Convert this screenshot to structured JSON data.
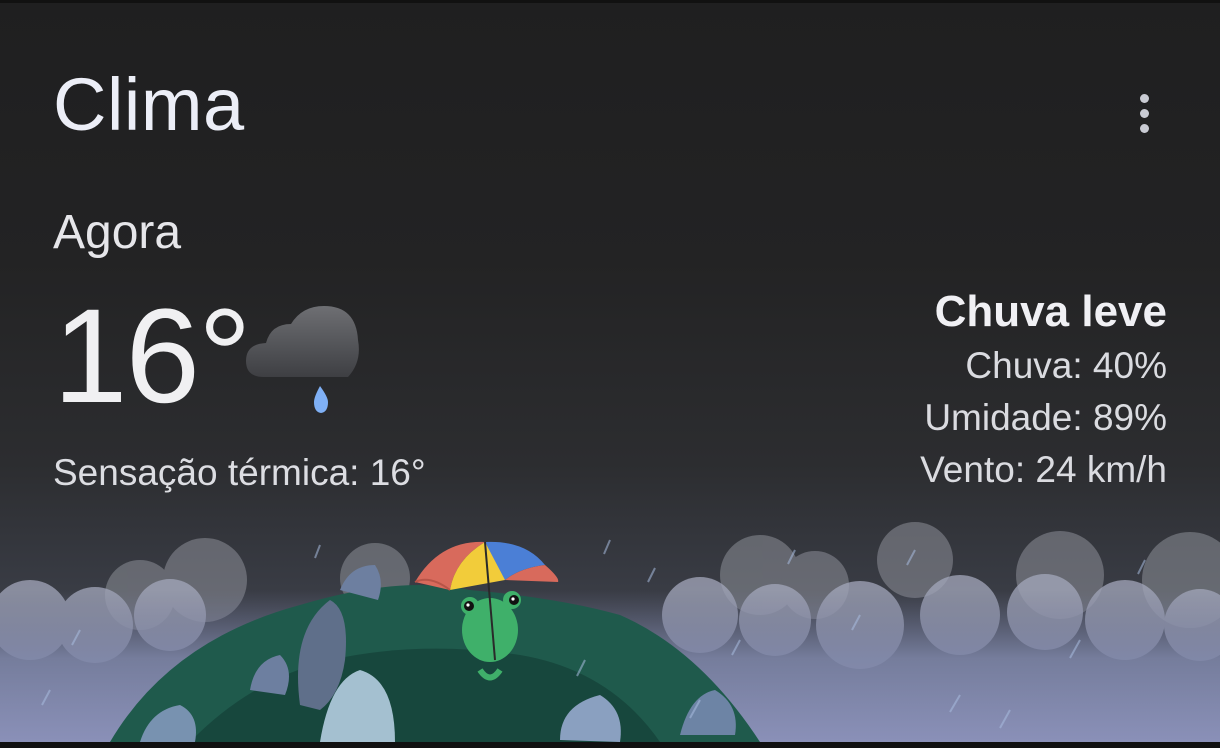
{
  "app": {
    "title": "Clima"
  },
  "header": {
    "menu_icon": "more-vert-icon"
  },
  "current": {
    "label": "Agora",
    "temperature": "16°",
    "feels_like": "Sensação térmica: 16°",
    "condition_icon": "rain-cloud-icon"
  },
  "details": {
    "condition": "Chuva leve",
    "rain": "Chuva: 40%",
    "humidity": "Umidade: 89%",
    "wind": "Vento: 24 km/h"
  },
  "colors": {
    "background": "#1e1e1f",
    "text": "#eceef7",
    "raindrop": "#7fb0f5",
    "hill": "#1f5a4c",
    "frog": "#3fb06a"
  }
}
